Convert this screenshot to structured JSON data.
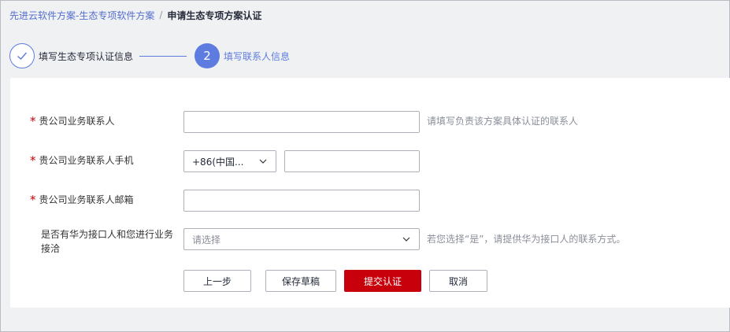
{
  "breadcrumb": {
    "parent": "先进云软件方案-生态专项软件方案",
    "separator": "/",
    "current": "申请生态专项方案认证"
  },
  "steps": [
    {
      "number": "",
      "label": "填写生态专项认证信息",
      "status": "done"
    },
    {
      "number": "2",
      "label": "填写联系人信息",
      "status": "active"
    }
  ],
  "form": {
    "required_mark": "*",
    "contact_name": {
      "label": "贵公司业务联系人",
      "value": "",
      "hint": "请填写负责该方案具体认证的联系人"
    },
    "contact_phone": {
      "label": "贵公司业务联系人手机",
      "country_code": "+86(中国...",
      "value": ""
    },
    "contact_email": {
      "label": "贵公司业务联系人邮箱",
      "value": ""
    },
    "huawei_contact": {
      "label": "是否有华为接口人和您进行业务接洽",
      "placeholder": "请选择",
      "hint": "若您选择“是”，请提供华为接口人的联系方式。"
    }
  },
  "buttons": {
    "prev": "上一步",
    "save_draft": "保存草稿",
    "submit": "提交认证",
    "cancel": "取消"
  },
  "colors": {
    "accent": "#5e7ce0",
    "primary_button": "#c7000b",
    "required": "#c7000b"
  }
}
